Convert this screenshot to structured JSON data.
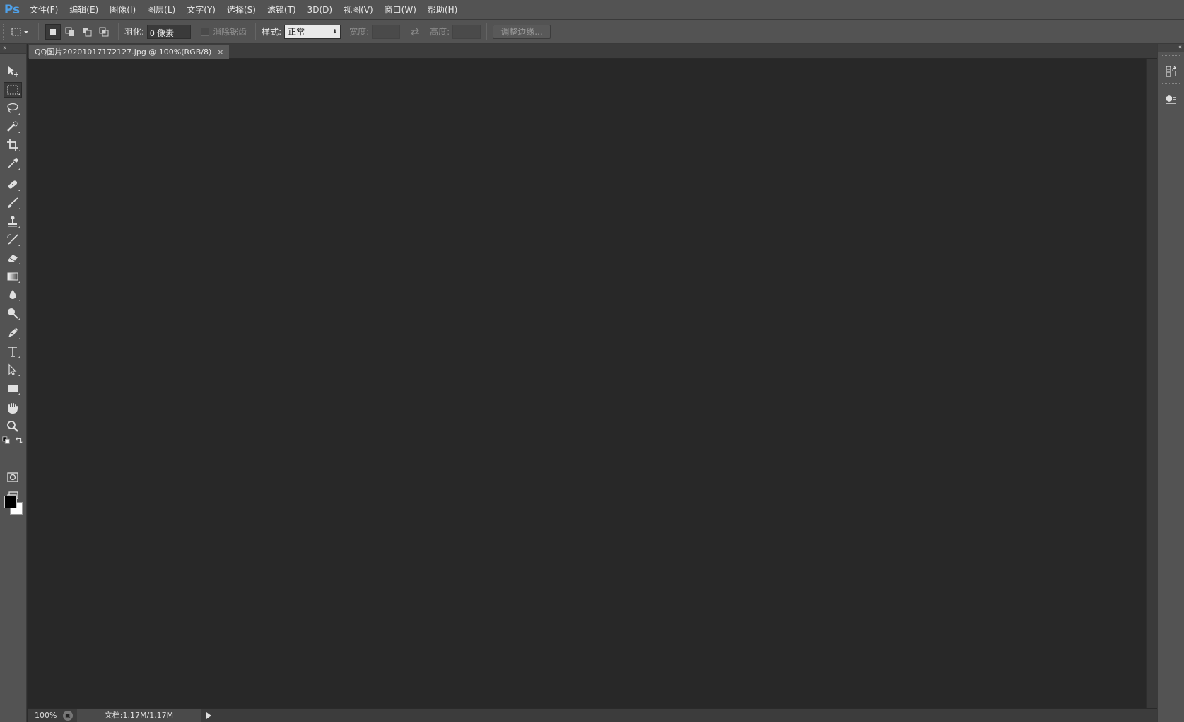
{
  "app": {
    "logo": "Ps"
  },
  "menu": [
    "文件(F)",
    "编辑(E)",
    "图像(I)",
    "图层(L)",
    "文字(Y)",
    "选择(S)",
    "滤镜(T)",
    "3D(D)",
    "视图(V)",
    "窗口(W)",
    "帮助(H)"
  ],
  "options": {
    "feather_label": "羽化:",
    "feather_value": "0 像素",
    "antialias_label": "消除锯齿",
    "style_label": "样式:",
    "style_value": "正常",
    "width_label": "宽度:",
    "height_label": "高度:",
    "refine_edge": "调整边缘..."
  },
  "document": {
    "tab_title": "QQ图片20201017172127.jpg @ 100%(RGB/8)",
    "close_glyph": "×"
  },
  "status": {
    "zoom": "100%",
    "doc_info": "文档:1.17M/1.17M"
  },
  "toolbar_collapse": "»",
  "rightpanel_collapse": "«",
  "colors": {
    "foreground": "#000000",
    "background": "#ffffff",
    "ui_panel": "#535353",
    "canvas": "#282828"
  }
}
